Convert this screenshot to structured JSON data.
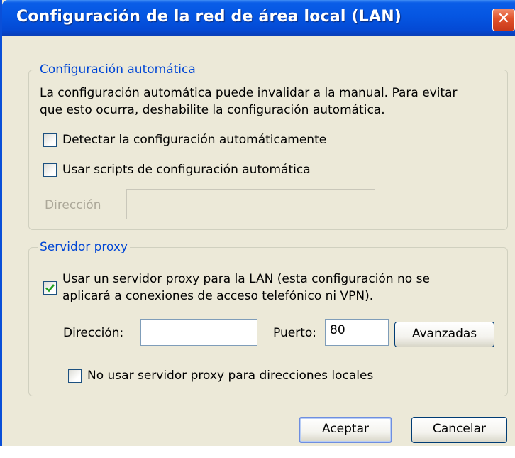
{
  "window": {
    "title": "Configuración de la red de área local (LAN)",
    "close_glyph": "✕"
  },
  "auto_config": {
    "legend": "Configuración automática",
    "description_line1": "La configuración automática puede invalidar a la manual. Para evitar",
    "description_line2": "que esto ocurra, deshabilite la configuración automática.",
    "detect_label": "Detectar la configuración automáticamente",
    "detect_checked": false,
    "scripts_label": "Usar scripts de configuración automática",
    "scripts_checked": false,
    "address_label": "Dirección",
    "address_value": ""
  },
  "proxy": {
    "legend": "Servidor proxy",
    "use_proxy_line1": "Usar un servidor proxy para la LAN (esta configuración no se",
    "use_proxy_line2": "aplicará a conexiones de acceso telefónico ni VPN).",
    "use_proxy_checked": true,
    "address_label": "Dirección:",
    "address_value": "",
    "port_label": "Puerto:",
    "port_value": "80",
    "advanced_label": "Avanzadas",
    "bypass_label": "No usar servidor proxy para direcciones locales",
    "bypass_checked": false
  },
  "buttons": {
    "accept": "Aceptar",
    "cancel": "Cancelar"
  }
}
